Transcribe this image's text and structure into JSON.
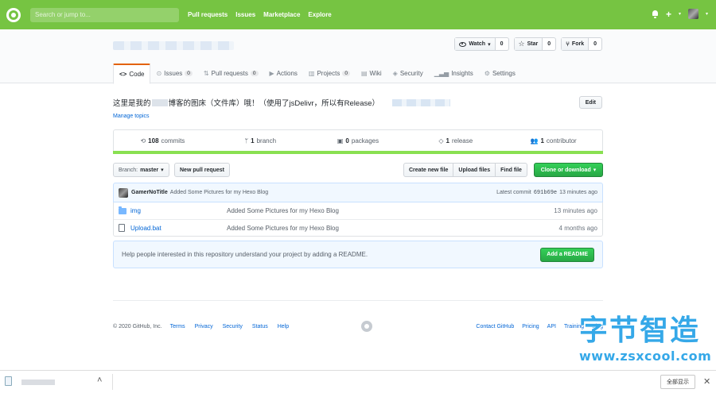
{
  "header": {
    "search_placeholder": "Search or jump to...",
    "nav": [
      "Pull requests",
      "Issues",
      "Marketplace",
      "Explore"
    ]
  },
  "repo": {
    "watch_label": "Watch",
    "watch_count": "0",
    "star_label": "Star",
    "star_count": "0",
    "fork_label": "Fork",
    "fork_count": "0",
    "tabs": [
      {
        "label": "Code",
        "icon": "code-icon",
        "counter": ""
      },
      {
        "label": "Issues",
        "icon": "issue-icon",
        "counter": "0"
      },
      {
        "label": "Pull requests",
        "icon": "pr-icon",
        "counter": "0"
      },
      {
        "label": "Actions",
        "icon": "play-icon",
        "counter": ""
      },
      {
        "label": "Projects",
        "icon": "project-icon",
        "counter": "0"
      },
      {
        "label": "Wiki",
        "icon": "book-icon",
        "counter": ""
      },
      {
        "label": "Security",
        "icon": "shield-icon",
        "counter": ""
      },
      {
        "label": "Insights",
        "icon": "graph-icon",
        "counter": ""
      },
      {
        "label": "Settings",
        "icon": "gear-icon",
        "counter": ""
      }
    ]
  },
  "description": {
    "part1": "这里是我的",
    "part2": "博客的图床（文件库）哦！（使用了jsDelivr，所以有Release）",
    "edit_label": "Edit",
    "manage_topics": "Manage topics"
  },
  "summary": {
    "commits_num": "108",
    "commits_label": "commits",
    "branch_num": "1",
    "branch_label": "branch",
    "packages_num": "0",
    "packages_label": "packages",
    "release_num": "1",
    "release_label": "release",
    "contrib_num": "1",
    "contrib_label": "contributor",
    "language_color": "#89e051"
  },
  "filenav": {
    "branch_label": "Branch:",
    "branch_name": "master",
    "new_pr": "New pull request",
    "create_file": "Create new file",
    "upload_files": "Upload files",
    "find_file": "Find file",
    "clone": "Clone or download"
  },
  "commit": {
    "author": "GamerNoTitle",
    "message": "Added Some Pictures for my Hexo Blog",
    "latest_label": "Latest commit",
    "sha": "691b69e",
    "age": "13 minutes ago"
  },
  "files": [
    {
      "name": "img",
      "type": "folder",
      "message": "Added Some Pictures for my Hexo Blog",
      "age": "13 minutes ago"
    },
    {
      "name": "Upload.bat",
      "type": "file",
      "message": "Added Some Pictures for my Hexo Blog",
      "age": "4 months ago"
    }
  ],
  "readme": {
    "text": "Help people interested in this repository understand your project by adding a README.",
    "button": "Add a README"
  },
  "footer": {
    "copyright": "© 2020 GitHub, Inc.",
    "left_links": [
      "Terms",
      "Privacy",
      "Security",
      "Status",
      "Help"
    ],
    "right_links": [
      "Contact GitHub",
      "Pricing",
      "API",
      "Training",
      "Blog"
    ]
  },
  "watermark": {
    "title": "字节智造",
    "url": "www.zsxcool.com"
  },
  "downloads": {
    "show_all": "全部显示"
  },
  "colors": {
    "header_bg": "#76c442",
    "primary_button": "#28a745",
    "link": "#0366d6",
    "selected_tab_accent": "#e36209"
  }
}
